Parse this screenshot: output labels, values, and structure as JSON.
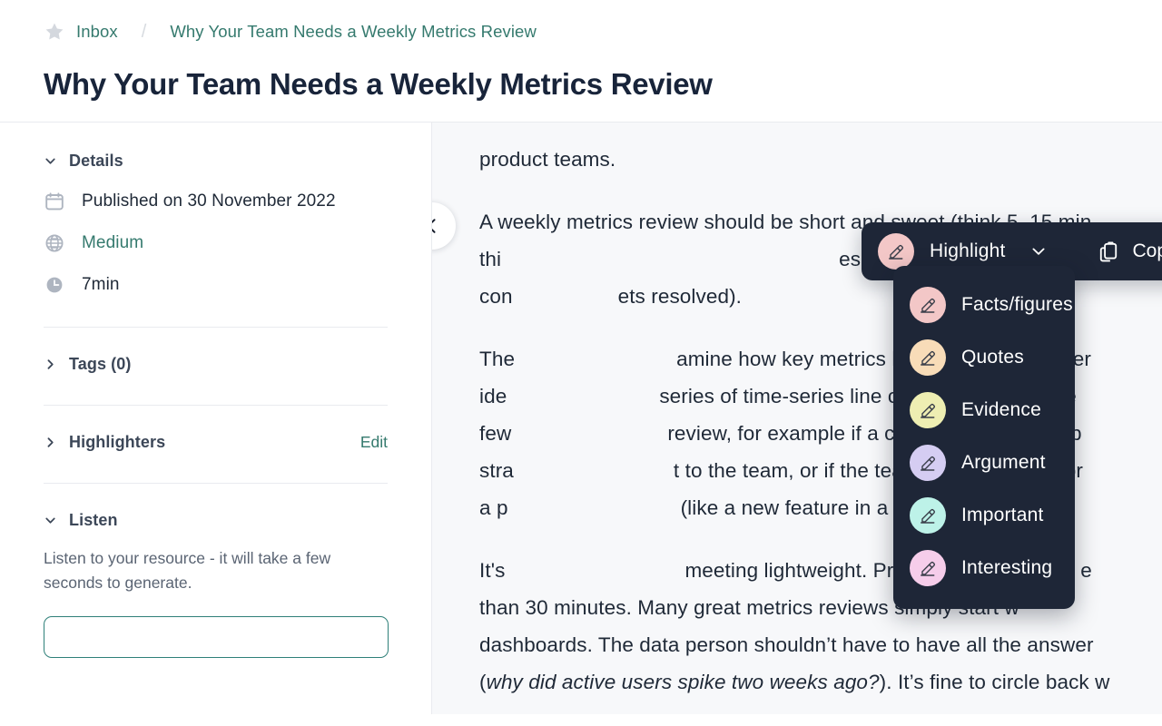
{
  "breadcrumb": {
    "star_icon": "star-icon",
    "inbox_label": "Inbox",
    "separator": "/",
    "current_label": "Why Your Team Needs a Weekly Metrics Review"
  },
  "page_title": "Why Your Team Needs a Weekly Metrics Review",
  "sidebar": {
    "details": {
      "title": "Details",
      "expanded": true,
      "rows": [
        {
          "icon": "calendar-icon",
          "text": "Published on 30 November 2022",
          "is_link": false
        },
        {
          "icon": "globe-icon",
          "text": "Medium",
          "is_link": true
        },
        {
          "icon": "clock-icon",
          "text": "7min",
          "is_link": false
        }
      ]
    },
    "tags": {
      "title": "Tags (0)",
      "expanded": false
    },
    "highlighters": {
      "title": "Highlighters",
      "expanded": false,
      "action_label": "Edit"
    },
    "listen": {
      "title": "Listen",
      "expanded": true,
      "description": "Listen to your resource - it will take a few seconds to generate."
    }
  },
  "collapse_button": {
    "icon": "chevron-left-icon"
  },
  "article": {
    "paragraphs": [
      {
        "id": "p1",
        "text": "product teams."
      },
      {
        "id": "p2",
        "highlighted_text": "A weekly metrics review should be short",
        "rest": " and sweet (think 5–15 min",
        "line2": "thi",
        "line2_rest": "es for your collective area of work (e.g. new us",
        "line3": "con",
        "line3_rest": "ets resolved)."
      },
      {
        "id": "p3",
        "line1": "The",
        "line1_rest": "amine how key metrics have progressed over",
        "line2": "ide",
        "line2_rest": "series of time-series line charts. The presente",
        "line3": "few",
        "line3_rest": "review, for example if a certain type of user, p",
        "line4": "stra",
        "line4_rest": "t to the team, or if the team has launched sor",
        "line5": "a p",
        "line5_rest": "(like a new feature in a test market)."
      },
      {
        "id": "p4",
        "line1": "It's",
        "line1_rest": "meeting lightweight. Preparation should be e",
        "line2": "than 30 minutes. Many great metrics reviews simply start w",
        "line3": "dashboards. The data person shouldn’t have to have all the answer",
        "line4_em": "why did active users spike two weeks ago?",
        "line4_rest": "). It’s fine to circle back w"
      }
    ]
  },
  "highlight_toolbar": {
    "swatch_icon": "highlighter-icon",
    "swatch_color": "#f3c7c7",
    "label": "Highlight",
    "caret_icon": "chevron-down-icon",
    "copy_icon": "clipboard-icon",
    "copy_label": "Copy",
    "twitter_icon": "twitter-icon"
  },
  "highlight_menu": {
    "items": [
      {
        "label": "Facts/figures",
        "color": "#f3c7c7",
        "icon": "highlighter-icon"
      },
      {
        "label": "Quotes",
        "color": "#f8dcb8",
        "icon": "highlighter-icon"
      },
      {
        "label": "Evidence",
        "color": "#eeeeb2",
        "icon": "highlighter-icon"
      },
      {
        "label": "Argument",
        "color": "#d5cdf2",
        "icon": "highlighter-icon"
      },
      {
        "label": "Important",
        "color": "#bdf2e8",
        "icon": "highlighter-icon"
      },
      {
        "label": "Interesting",
        "color": "#f6cdea",
        "icon": "highlighter-icon"
      }
    ]
  },
  "colors": {
    "accent_teal": "#357a6e",
    "toolbar_bg": "#1e2637",
    "article_bg": "#f7f8fa",
    "highlight_pink": "#f9dcdc"
  }
}
